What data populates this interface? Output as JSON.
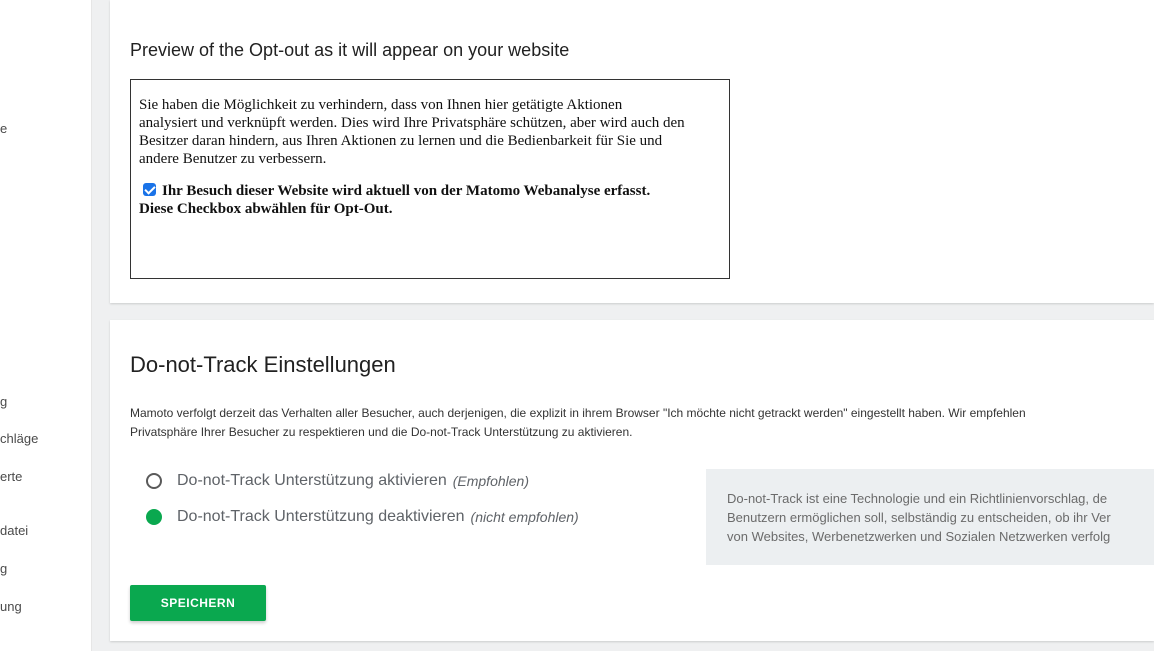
{
  "sidebar": {
    "items": [
      "e",
      "g",
      "chläge",
      "erte",
      "datei",
      "g",
      "ung"
    ]
  },
  "preview": {
    "title": "Preview of the Opt-out as it will appear on your website",
    "intro_line1": "Sie haben die Möglichkeit zu verhindern, dass von Ihnen hier getätigte Aktionen",
    "intro_line2": "analysiert und verknüpft werden. Dies wird Ihre Privatsphäre schützen, aber wird auch den",
    "intro_line3": "Besitzer daran hindern, aus Ihren Aktionen zu lernen und die Bedienbarkeit für Sie und",
    "intro_line4": "andere Benutzer zu verbessern.",
    "optout_line1": "Ihr Besuch dieser Website wird aktuell von der Matomo Webanalyse erfasst.",
    "optout_line2": "Diese Checkbox abwählen für Opt-Out.",
    "checkbox_checked": true
  },
  "dnt": {
    "title": "Do-not-Track Einstellungen",
    "desc_line1": "Mamoto verfolgt derzeit das Verhalten aller Besucher, auch derjenigen, die explizit in ihrem Browser \"Ich möchte nicht getrackt werden\" eingestellt haben. Wir empfehlen",
    "desc_line2": "Privatsphäre Ihrer Besucher zu respektieren und die Do-not-Track Unterstützung zu aktivieren.",
    "option_enable": "Do-not-Track Unterstützung aktivieren",
    "option_enable_hint": "(Empfohlen)",
    "option_disable": "Do-not-Track Unterstützung deaktivieren",
    "option_disable_hint": "(nicht empfohlen)",
    "selected": "disable",
    "info_line1": "Do-not-Track ist eine Technologie und ein Richtlinienvorschlag, de",
    "info_line2": "Benutzern ermöglichen soll, selbständig zu entscheiden, ob ihr Ver",
    "info_line3": "von Websites, Werbenetzwerken und Sozialen Netzwerken verfolg",
    "save_label": "SPEICHERN"
  },
  "colors": {
    "accent_green": "#0aa84f",
    "checkbox_blue": "#1a73e8"
  }
}
